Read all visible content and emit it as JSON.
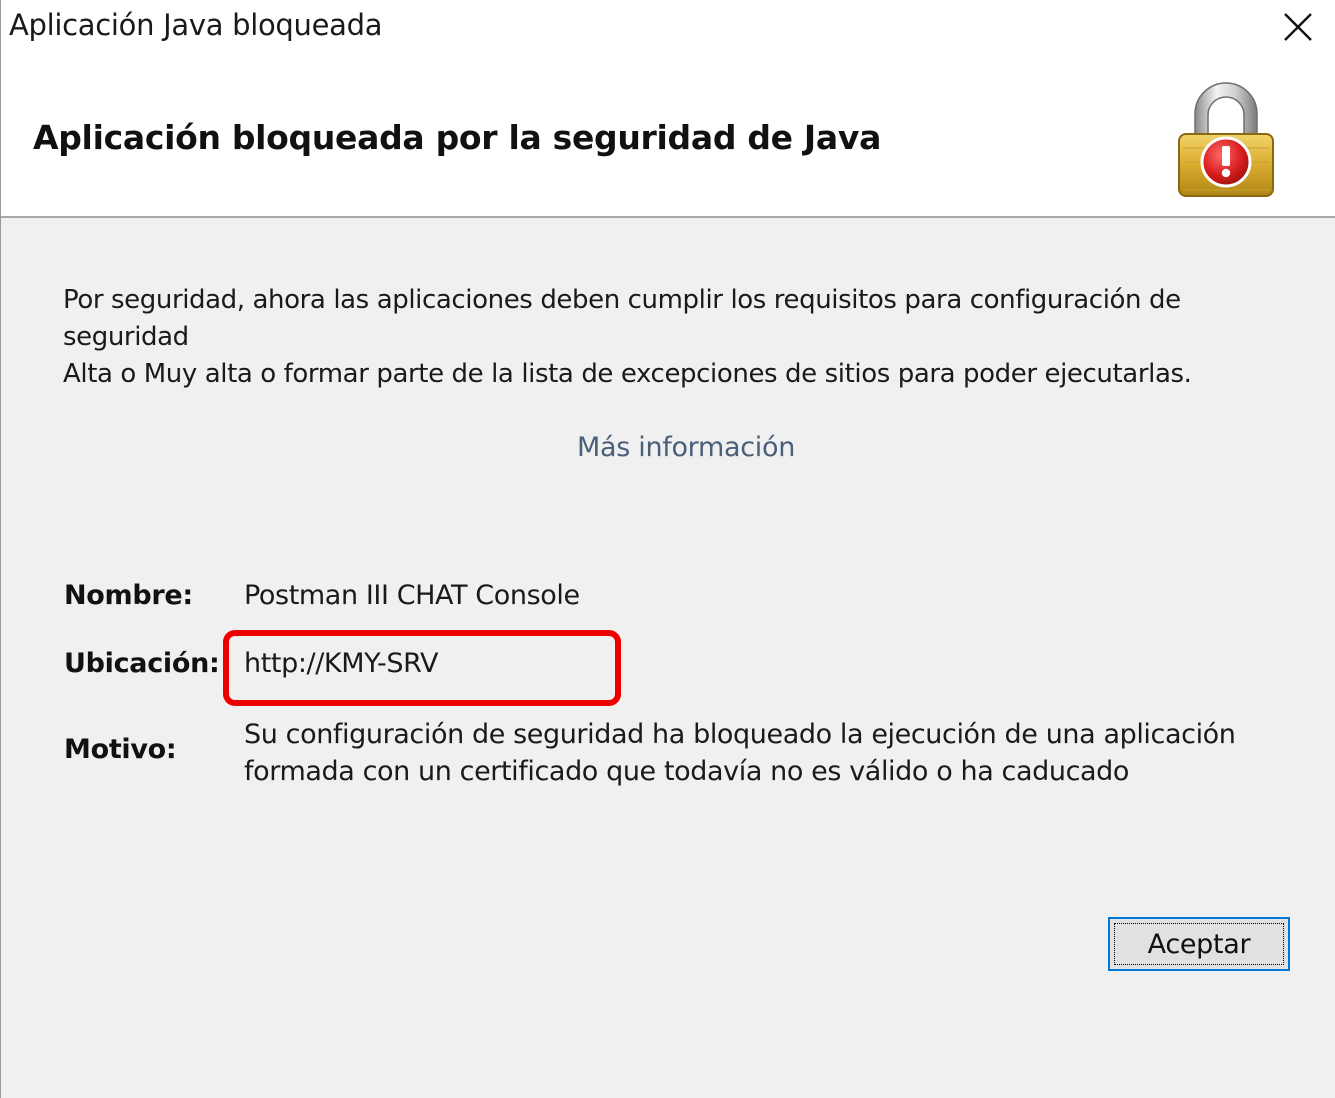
{
  "window": {
    "title": "Aplicación Java bloqueada",
    "close_icon": "close-icon"
  },
  "header": {
    "title": "Aplicación bloqueada por la seguridad de Java",
    "icon": "padlock-warning-icon"
  },
  "message": {
    "line1": "Por seguridad, ahora las aplicaciones deben cumplir los requisitos para configuración de seguridad",
    "line2": "Alta o Muy alta o formar parte de la lista de excepciones de sitios para poder ejecutarlas."
  },
  "more_info_link": "Más información",
  "details": {
    "name_label": "Nombre:",
    "name_value": "Postman III CHAT Console",
    "location_label": "Ubicación:",
    "location_value": "http://KMY-SRV",
    "reason_label": "Motivo:",
    "reason_line1": "Su configuración de seguridad ha bloqueado la ejecución de una aplicación",
    "reason_line2": "formada con un certificado que todavía no es válido o ha caducado"
  },
  "buttons": {
    "ok_label": "Aceptar"
  },
  "colors": {
    "highlight": "#ee0000",
    "focus_border": "#0078d7",
    "link": "#4a5f78",
    "lock_body": "#d4a52a",
    "warning_badge": "#d91e1e"
  }
}
